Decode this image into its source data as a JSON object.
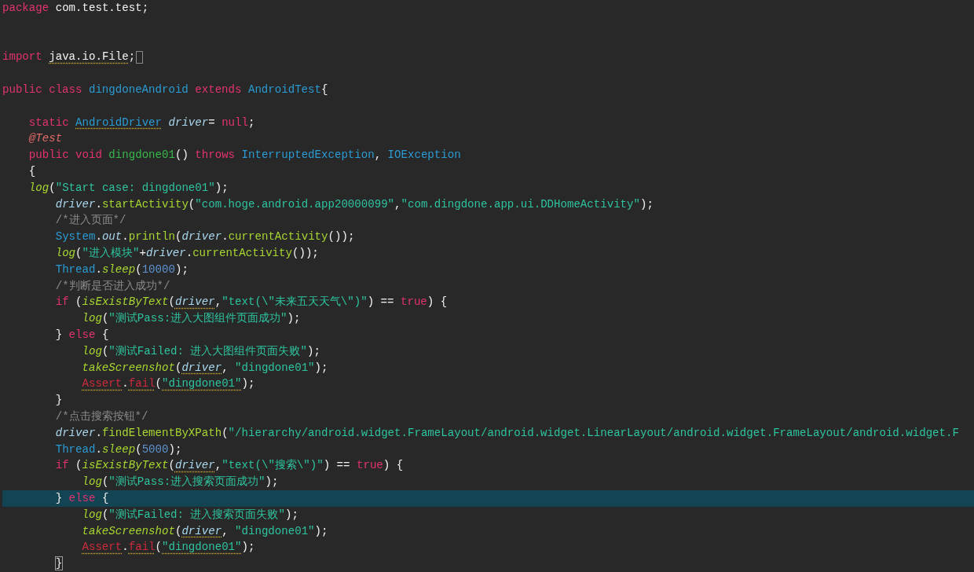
{
  "lines": [
    {
      "selected": false,
      "tokens": [
        {
          "t": "package",
          "kind": "kw"
        },
        {
          "t": " com.test.test;",
          "kind": "plain"
        }
      ]
    },
    {
      "selected": false
    },
    {
      "selected": false
    },
    {
      "selected": false,
      "tokens": [
        {
          "t": "import ",
          "kind": "kw"
        },
        {
          "t": "java.io.File",
          "kind": "plain",
          "warn": true
        },
        {
          "t": ";",
          "kind": "plain"
        },
        {
          "kind": "fold"
        }
      ]
    },
    {
      "selected": false
    },
    {
      "selected": false,
      "tokens": [
        {
          "t": "public class ",
          "kind": "kw"
        },
        {
          "t": "dingdoneAndroid ",
          "kind": "type"
        },
        {
          "t": "extends ",
          "kind": "kw"
        },
        {
          "t": "AndroidTest",
          "kind": "type"
        },
        {
          "t": "{",
          "kind": "plain"
        }
      ]
    },
    {
      "selected": false
    },
    {
      "selected": false,
      "tokens": [
        {
          "t": "    static ",
          "kind": "kw"
        },
        {
          "t": "AndroidDriver",
          "kind": "type",
          "warn": true
        },
        {
          "t": " driver",
          "kind": "var"
        },
        {
          "t": "= ",
          "kind": "plain"
        },
        {
          "t": "null",
          "kind": "kw"
        },
        {
          "t": ";",
          "kind": "plain"
        }
      ]
    },
    {
      "selected": false,
      "tokens": [
        {
          "t": "    @Test",
          "kind": "ann"
        }
      ]
    },
    {
      "selected": false,
      "tokens": [
        {
          "t": "    public void ",
          "kind": "kw"
        },
        {
          "t": "dingdone01",
          "kind": "decl"
        },
        {
          "t": "() ",
          "kind": "plain"
        },
        {
          "t": "throws ",
          "kind": "kw"
        },
        {
          "t": "InterruptedException",
          "kind": "type"
        },
        {
          "t": ", ",
          "kind": "plain"
        },
        {
          "t": "IOException",
          "kind": "type"
        }
      ]
    },
    {
      "selected": false,
      "tokens": [
        {
          "t": "    {",
          "kind": "plain"
        }
      ]
    },
    {
      "selected": false,
      "tokens": [
        {
          "t": "    log",
          "kind": "fnit"
        },
        {
          "t": "(",
          "kind": "plain"
        },
        {
          "t": "\"Start case: dingdone01\"",
          "kind": "str"
        },
        {
          "t": ");",
          "kind": "plain"
        }
      ]
    },
    {
      "selected": false,
      "tokens": [
        {
          "t": "        driver",
          "kind": "var"
        },
        {
          "t": ".",
          "kind": "plain"
        },
        {
          "t": "startActivity",
          "kind": "fn"
        },
        {
          "t": "(",
          "kind": "plain"
        },
        {
          "t": "\"com.hoge.android.app20000099\"",
          "kind": "str"
        },
        {
          "t": ",",
          "kind": "plain"
        },
        {
          "t": "\"com.dingdone.app.ui.DDHomeActivity\"",
          "kind": "str"
        },
        {
          "t": ");",
          "kind": "plain"
        }
      ]
    },
    {
      "selected": false,
      "tokens": [
        {
          "t": "        /*进入页面*/",
          "kind": "com"
        }
      ]
    },
    {
      "selected": false,
      "tokens": [
        {
          "t": "        System",
          "kind": "type"
        },
        {
          "t": ".",
          "kind": "plain"
        },
        {
          "t": "out",
          "kind": "var"
        },
        {
          "t": ".",
          "kind": "plain"
        },
        {
          "t": "println",
          "kind": "fn"
        },
        {
          "t": "(",
          "kind": "plain"
        },
        {
          "t": "driver",
          "kind": "var"
        },
        {
          "t": ".",
          "kind": "plain"
        },
        {
          "t": "currentActivity",
          "kind": "fn"
        },
        {
          "t": "());",
          "kind": "plain"
        }
      ]
    },
    {
      "selected": false,
      "tokens": [
        {
          "t": "        log",
          "kind": "fnit"
        },
        {
          "t": "(",
          "kind": "plain"
        },
        {
          "t": "\"进入模块\"",
          "kind": "str"
        },
        {
          "t": "+",
          "kind": "plain"
        },
        {
          "t": "driver",
          "kind": "var"
        },
        {
          "t": ".",
          "kind": "plain"
        },
        {
          "t": "currentActivity",
          "kind": "fn"
        },
        {
          "t": "());",
          "kind": "plain"
        }
      ]
    },
    {
      "selected": false,
      "tokens": [
        {
          "t": "        Thread",
          "kind": "type"
        },
        {
          "t": ".",
          "kind": "plain"
        },
        {
          "t": "sleep",
          "kind": "fnit"
        },
        {
          "t": "(",
          "kind": "plain"
        },
        {
          "t": "10000",
          "kind": "num"
        },
        {
          "t": ");",
          "kind": "plain"
        }
      ]
    },
    {
      "selected": false,
      "tokens": [
        {
          "t": "        /*判断是否进入成功*/",
          "kind": "com"
        }
      ]
    },
    {
      "selected": false,
      "tokens": [
        {
          "t": "        if",
          "kind": "kw"
        },
        {
          "t": " (",
          "kind": "plain"
        },
        {
          "t": "isExistByText",
          "kind": "fnit"
        },
        {
          "t": "(",
          "kind": "plain"
        },
        {
          "t": "driver",
          "kind": "var",
          "warn": true
        },
        {
          "t": ",",
          "kind": "plain"
        },
        {
          "t": "\"text(\\\"未来五天天气\\\")\"",
          "kind": "str"
        },
        {
          "t": ") == ",
          "kind": "plain"
        },
        {
          "t": "true",
          "kind": "kw"
        },
        {
          "t": ") {",
          "kind": "plain"
        }
      ]
    },
    {
      "selected": false,
      "tokens": [
        {
          "t": "            log",
          "kind": "fnit"
        },
        {
          "t": "(",
          "kind": "plain"
        },
        {
          "t": "\"测试Pass:进入大图组件页面成功\"",
          "kind": "str"
        },
        {
          "t": ");",
          "kind": "plain"
        }
      ]
    },
    {
      "selected": false,
      "tokens": [
        {
          "t": "        } ",
          "kind": "plain"
        },
        {
          "t": "else",
          "kind": "kw"
        },
        {
          "t": " {",
          "kind": "plain"
        }
      ]
    },
    {
      "selected": false,
      "tokens": [
        {
          "t": "            log",
          "kind": "fnit"
        },
        {
          "t": "(",
          "kind": "plain"
        },
        {
          "t": "\"测试Failed: 进入大图组件页面失败\"",
          "kind": "str"
        },
        {
          "t": ");",
          "kind": "plain"
        }
      ]
    },
    {
      "selected": false,
      "tokens": [
        {
          "t": "            takeScreenshot",
          "kind": "fnit"
        },
        {
          "t": "(",
          "kind": "plain"
        },
        {
          "t": "driver",
          "kind": "var",
          "warn": true
        },
        {
          "t": ", ",
          "kind": "plain"
        },
        {
          "t": "\"dingdone01\"",
          "kind": "str"
        },
        {
          "t": ");",
          "kind": "plain"
        }
      ]
    },
    {
      "selected": false,
      "tokens": [
        {
          "t": "            Assert",
          "kind": "err",
          "warn": true
        },
        {
          "t": ".",
          "kind": "plain"
        },
        {
          "t": "fail",
          "kind": "err",
          "warn": true
        },
        {
          "t": "(",
          "kind": "plain"
        },
        {
          "t": "\"dingdone01\"",
          "kind": "str",
          "warn": true
        },
        {
          "t": ");",
          "kind": "plain"
        }
      ]
    },
    {
      "selected": false,
      "tokens": [
        {
          "t": "        }",
          "kind": "plain"
        }
      ]
    },
    {
      "selected": false,
      "tokens": [
        {
          "t": "        /*点击搜索按钮*/",
          "kind": "com"
        }
      ]
    },
    {
      "selected": false,
      "tokens": [
        {
          "t": "        driver",
          "kind": "var"
        },
        {
          "t": ".",
          "kind": "plain"
        },
        {
          "t": "findElementByXPath",
          "kind": "fn"
        },
        {
          "t": "(",
          "kind": "plain"
        },
        {
          "t": "\"/hierarchy/android.widget.FrameLayout/android.widget.LinearLayout/android.widget.FrameLayout/android.widget.F",
          "kind": "str"
        }
      ]
    },
    {
      "selected": false,
      "tokens": [
        {
          "t": "        Thread",
          "kind": "type"
        },
        {
          "t": ".",
          "kind": "plain"
        },
        {
          "t": "sleep",
          "kind": "fnit"
        },
        {
          "t": "(",
          "kind": "plain"
        },
        {
          "t": "5000",
          "kind": "num"
        },
        {
          "t": ");",
          "kind": "plain"
        }
      ]
    },
    {
      "selected": false,
      "tokens": [
        {
          "t": "        if",
          "kind": "kw"
        },
        {
          "t": " (",
          "kind": "plain"
        },
        {
          "t": "isExistByText",
          "kind": "fnit"
        },
        {
          "t": "(",
          "kind": "plain"
        },
        {
          "t": "driver",
          "kind": "var",
          "warn": true
        },
        {
          "t": ",",
          "kind": "plain"
        },
        {
          "t": "\"text(\\\"搜索\\\")\"",
          "kind": "str"
        },
        {
          "t": ") == ",
          "kind": "plain"
        },
        {
          "t": "true",
          "kind": "kw"
        },
        {
          "t": ") {",
          "kind": "plain"
        }
      ]
    },
    {
      "selected": false,
      "tokens": [
        {
          "t": "            log",
          "kind": "fnit"
        },
        {
          "t": "(",
          "kind": "plain"
        },
        {
          "t": "\"测试Pass:进入搜索页面成功\"",
          "kind": "str"
        },
        {
          "t": ");",
          "kind": "plain"
        }
      ]
    },
    {
      "selected": true,
      "tokens": [
        {
          "t": "        } ",
          "kind": "plain"
        },
        {
          "t": "else",
          "kind": "kw"
        },
        {
          "t": " {",
          "kind": "plain"
        }
      ]
    },
    {
      "selected": false,
      "tokens": [
        {
          "t": "            log",
          "kind": "fnit"
        },
        {
          "t": "(",
          "kind": "plain"
        },
        {
          "t": "\"测试Failed: 进入搜索页面失败\"",
          "kind": "str"
        },
        {
          "t": ");",
          "kind": "plain"
        }
      ]
    },
    {
      "selected": false,
      "tokens": [
        {
          "t": "            takeScreenshot",
          "kind": "fnit"
        },
        {
          "t": "(",
          "kind": "plain"
        },
        {
          "t": "driver",
          "kind": "var",
          "warn": true
        },
        {
          "t": ", ",
          "kind": "plain"
        },
        {
          "t": "\"dingdone01\"",
          "kind": "str"
        },
        {
          "t": ");",
          "kind": "plain"
        }
      ]
    },
    {
      "selected": false,
      "tokens": [
        {
          "t": "            Assert",
          "kind": "err",
          "warn": true
        },
        {
          "t": ".",
          "kind": "plain"
        },
        {
          "t": "fail",
          "kind": "err",
          "warn": true
        },
        {
          "t": "(",
          "kind": "plain"
        },
        {
          "t": "\"dingdone01\"",
          "kind": "str",
          "warn": true
        },
        {
          "t": ");",
          "kind": "plain"
        }
      ]
    },
    {
      "selected": false,
      "tokens": [
        {
          "t": "        }",
          "kind": "match"
        }
      ]
    }
  ]
}
